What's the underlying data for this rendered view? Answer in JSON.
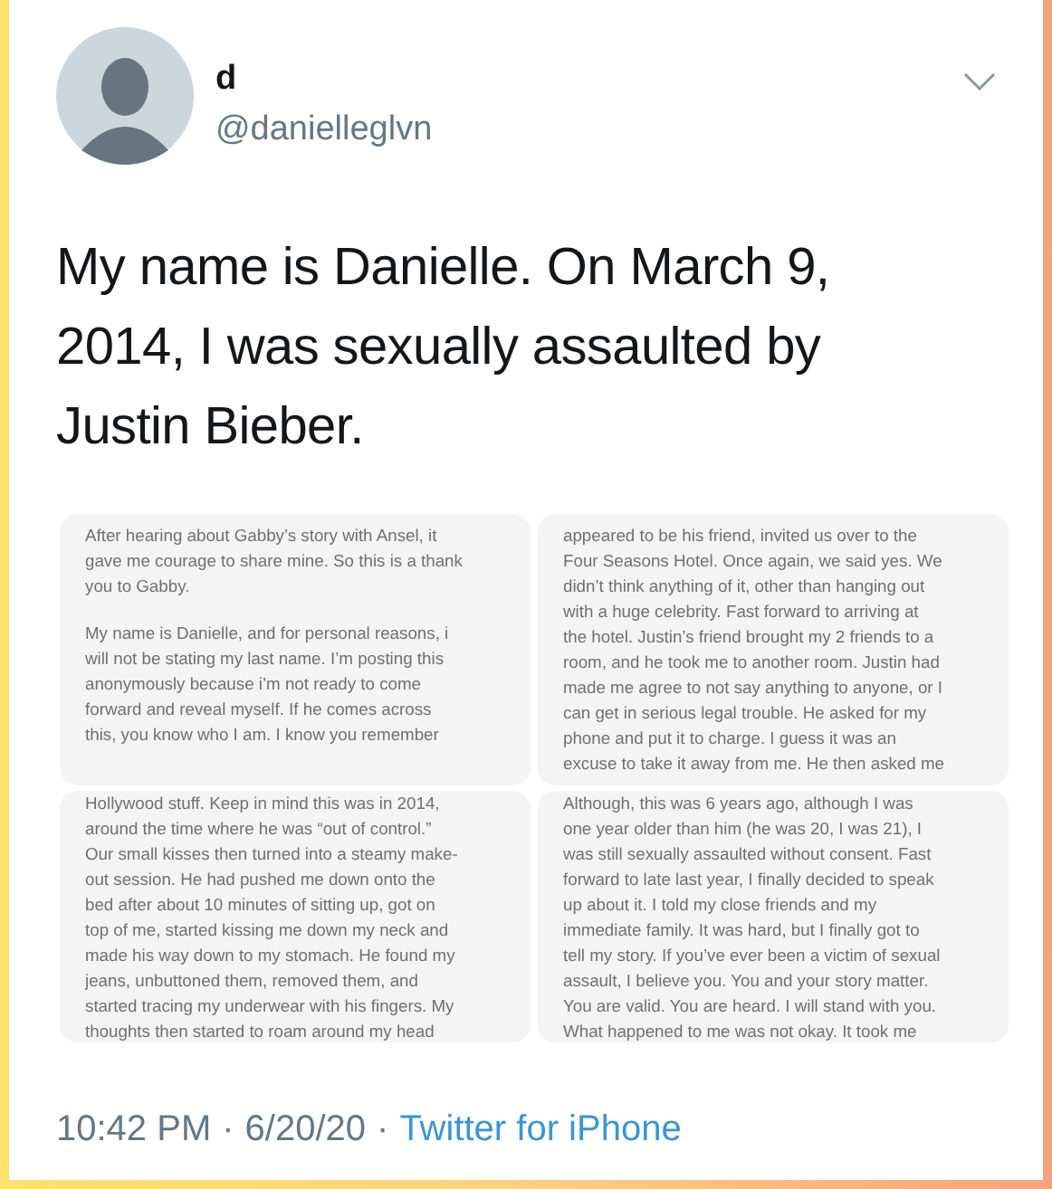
{
  "tweet": {
    "display_name": "d",
    "handle": "@danielleglvn",
    "text": "My name is Danielle. On March 9, 2014, I was sexually assaulted by Justin Bieber.",
    "images": [
      {
        "paragraphs": [
          "After hearing about Gabby’s story with Ansel, it\ngave me courage to share mine. So this is a thank\nyou to Gabby.",
          "My name is Danielle, and for personal reasons, i\nwill not be stating my last name. I’m posting this\nanonymously because i’m not ready to come\nforward and reveal myself. If he comes across\nthis, you know who I am. I know you remember"
        ]
      },
      {
        "paragraphs": [
          "appeared to be his friend, invited us over to the\nFour Seasons Hotel. Once again, we said yes. We\ndidn’t think anything of it, other than hanging out\nwith a huge celebrity. Fast forward to arriving at\nthe hotel. Justin’s friend brought my 2 friends to a\nroom, and he took me to another room. Justin had\nmade me agree to not say anything to anyone, or I\ncan get in serious legal trouble. He asked for my\nphone and put it to charge. I guess it was an\nexcuse to take it away from me. He then asked me"
        ]
      },
      {
        "paragraphs": [
          "Hollywood stuff.  Keep in mind this was in 2014,\naround the time where he was “out of control.”\nOur small kisses then turned into a steamy make-\nout session. He had pushed me down onto the\nbed after about 10 minutes of sitting up, got on\ntop of me, started kissing me down my neck and\nmade his way down to my stomach. He found my\njeans, unbuttoned them, removed them, and\nstarted tracing my underwear with his fingers. My\nthoughts then started to roam around my head"
        ]
      },
      {
        "paragraphs": [
          "Although, this was 6 years ago, although I was\none year older than him (he was 20, I was 21), I\nwas still sexually assaulted without consent. Fast\nforward to late last year, I finally decided to speak\nup about it. I told my close friends and my\nimmediate family. It was hard, but I finally got to\ntell my story. If you’ve ever been a victim of sexual\nassault, I believe you. You and your story matter.\nYou are valid. You are heard. I will stand with you.\nWhat happened to me was not okay. It took me"
        ]
      }
    ],
    "time": "10:42 PM",
    "separator_1": "·",
    "date": "6/20/20",
    "separator_2": "·",
    "source": "Twitter for iPhone"
  }
}
